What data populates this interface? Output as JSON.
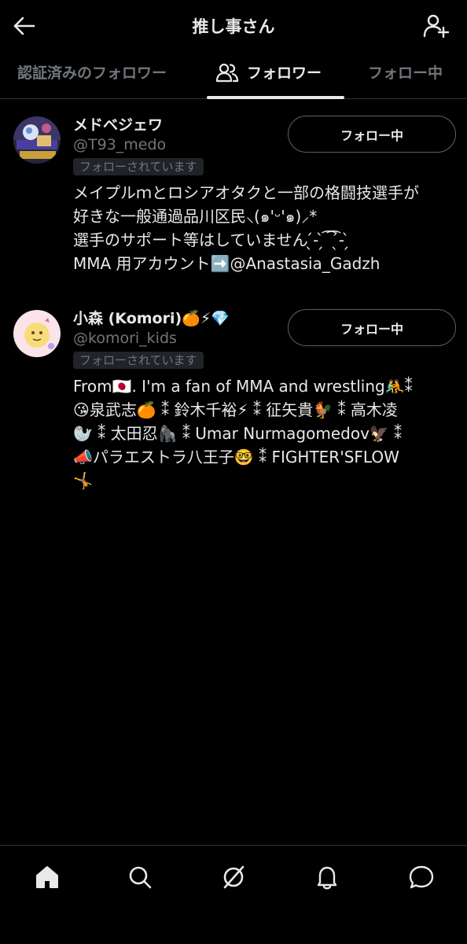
{
  "header": {
    "title": "推し事さん",
    "back_icon": "arrow-left-icon",
    "add_user_icon": "add-user-icon"
  },
  "tabs": [
    {
      "label": "認証済みのフォロワー",
      "active": false
    },
    {
      "label": "フォロワー",
      "active": true
    },
    {
      "label": "フォロー中",
      "active": false
    }
  ],
  "users": [
    {
      "name": "メドベジェワ",
      "handle": "@T93_medo",
      "follows_you": "フォローされています",
      "button": "フォロー中",
      "bio_lines": [
        "メイプルｍとロシアオタクと一部の格闘技選手が",
        "好きな一般通過品川区民⸜(๑'ᵕ'๑)⸝*",
        "選手のサポート等はしていません ̖́- ̗̀ ͡  ͡ ̖́- ̗̀",
        "MMA 用アカウント➡️@Anastasia_Gadzh"
      ]
    },
    {
      "name": "小森 (Komori)🍊⚡💎",
      "handle": "@komori_kids",
      "follows_you": "フォローされています",
      "button": "フォロー中",
      "bio_lines": [
        "From🇯🇵. I'm a fan of MMA and wrestling🤼⁑",
        "😘泉武志🍊 ⁑ 鈴木千裕⚡ ⁑ 征矢貴🐓 ⁑ 高木凌",
        "🦭 ⁑ 太田忍🦍 ⁑ Umar Nurmagomedov🦅 ⁑",
        "📣パラエストラ八王子🤓 ⁑ FIGHTER'SFLOW",
        "🤸"
      ]
    }
  ],
  "bottom_nav": [
    {
      "icon": "home-icon"
    },
    {
      "icon": "search-icon"
    },
    {
      "icon": "grok-icon"
    },
    {
      "icon": "notifications-icon"
    },
    {
      "icon": "messages-icon"
    }
  ]
}
